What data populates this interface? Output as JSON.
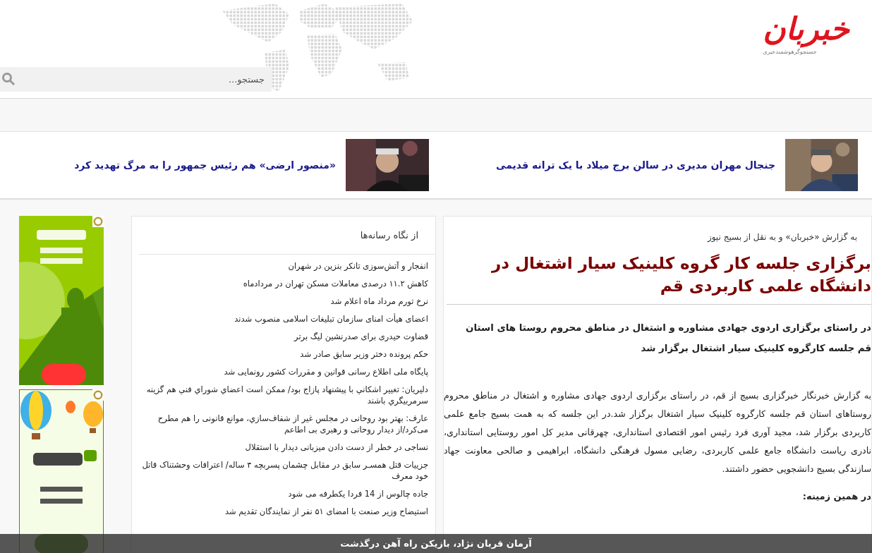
{
  "header": {
    "logo": "خبربان",
    "tagline": "جستجوگرهوشمندخبری",
    "search": {
      "placeholder": "جستجو..."
    }
  },
  "top_stories": [
    {
      "title": "جنجال مهران مدیری در سالن برج میلاد با یک ترانه قدیمی",
      "kind": "picture"
    },
    {
      "title": "«منصور ارضی» هم رئیس جمهور را به مرگ تهدید کرد",
      "kind": "picture"
    }
  ],
  "article": {
    "source": "به گزارش «خبربان» و به نقل از بسیج نیوز",
    "title": "برگزاری جلسه کار گروه کلینیک سیار اشتغال در دانشگاه علمی کاربردی قم",
    "lead": "در راستای برگزاری اردوی جهادی مشاوره و اشتغال در مناطق محروم روستا های استان قم جلسه کارگروه کلینیک سیار اشتغال برگزار شد",
    "body": "به گزارش خبرنگار خبرگزاری بسیج از قم، در راستای برگزاری اردوی جهادی مشاوره و اشتغال در مناطق محروم روستاهای استان قم جلسه کارگروه کلینیک سیار اشتغال برگزار شد.در این جلسه که به همت بسیج جامع علمی کاربردی برگزار شد، مجید آوری فرد رئیس امور اقتصادی استانداری، چهرقانی مدیر کل امور روستایی استانداری، نادری ریاست دانشگاه جامع علمی کاربردی، رضایی مسول فرهنگی دانشگاه، ابراهیمی و صالحی معاونت جهاد سازندگی بسیج دانشجویی حضور داشتند.",
    "related_heading": "در همین زمینه:"
  },
  "media_box": {
    "title": "از نگاه رسانه‌ها",
    "items": [
      "انفجار و آتش‌سوزی تانکر بنزین در شهران",
      "کاهش ۱۱.۲ درصدی معاملات مسکن تهران در مردادماه",
      "نرخ تورم مرداد ماه اعلام شد",
      "اعضای هیأت امنای سازمان تبلیغات اسلامی منصوب شدند",
      "قضاوت حیدری برای صدرنشین لیگ برتر",
      "حکم پرونده دختر وزیر سابق صادر شد",
      "پایگاه ملی اطلاع رسانی قوانین و مقررات کشور رونمایی شد",
      "دليريان: تغيير اشكاني با پيشنهاد پازاج بود/ ممكن است اعضاي شوراي فني هم گزينه سرمربيگري باشند",
      "عارف: بهتر بود روحانی در مجلس غیر از شفاف‌سازي، موانع قانونی را هم مطرح می‌کرد/از دیدار روحانی و رهبری بی اطاعم",
      "نساجی در خطر از دست دادن میزبانی دیدار با استقلال",
      "جزییات قتل همسـر سابق در مقابل چشمان پسربچه ۴ ساله/ اعترافات وحشتناک قاتل خود معرف",
      "جاده چالوس از 14 فردا یکطرفه می شود",
      "استیضاح وزیر صنعت با امضای ۵۱ نفر از نمایندگان تقدیم شد"
    ]
  },
  "ticker": {
    "text": "آرمان قربان نژاد، بازیکن راه آهن درگذشت"
  }
}
